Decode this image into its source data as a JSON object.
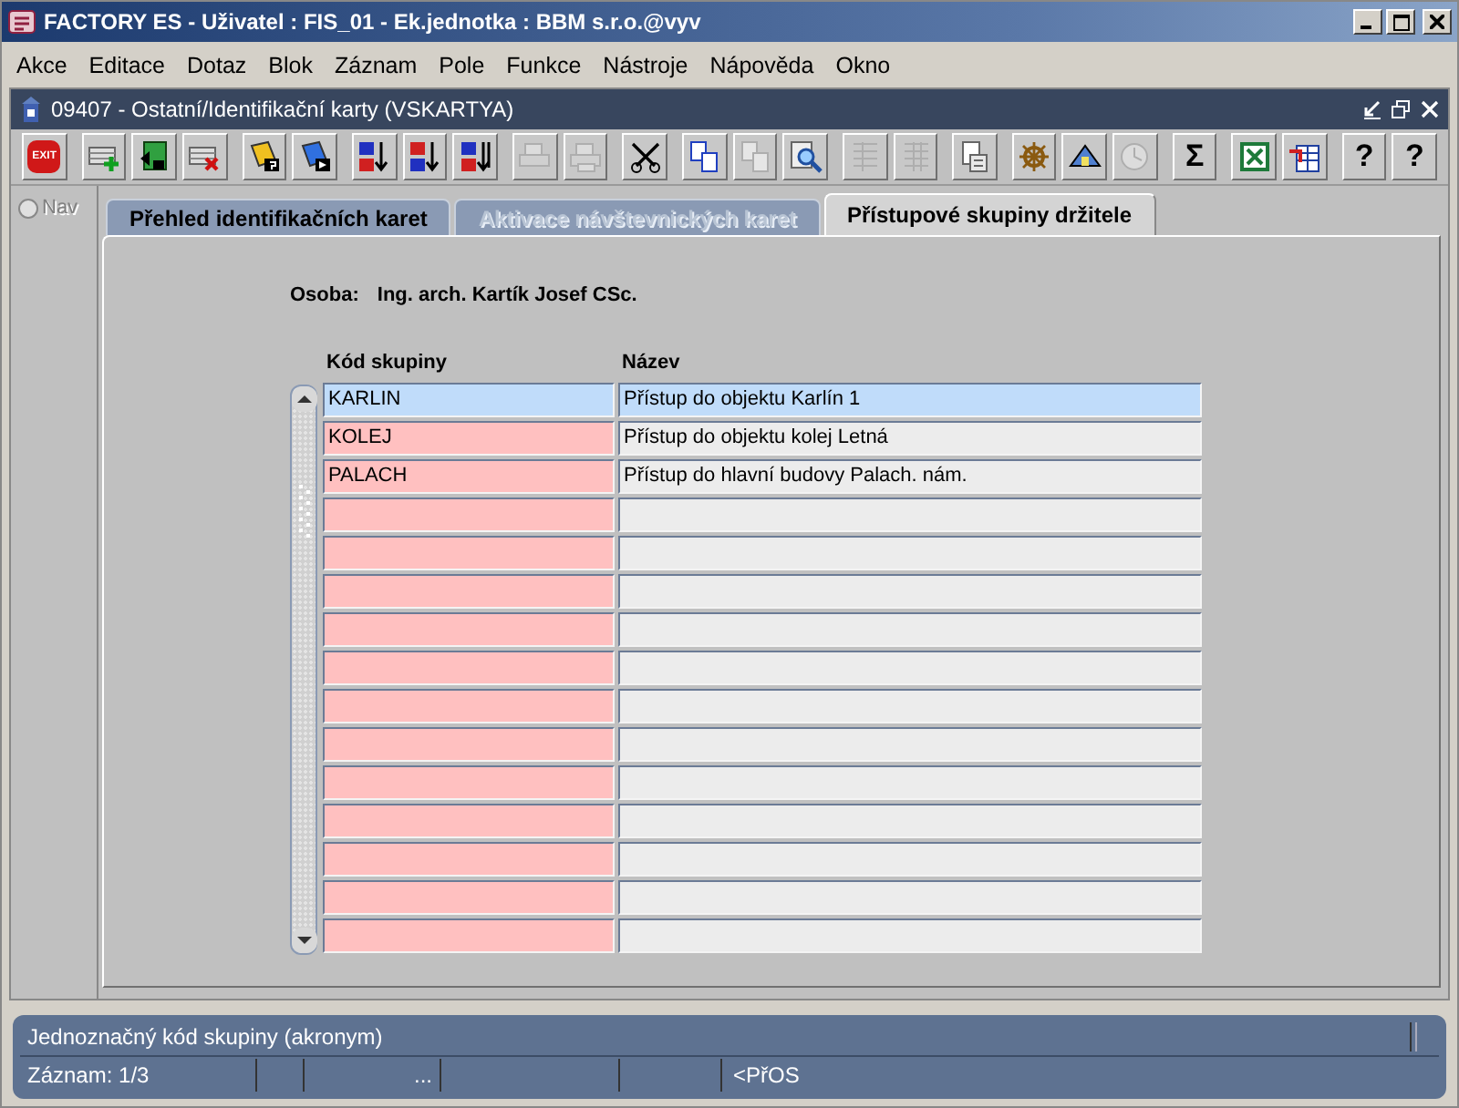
{
  "window": {
    "title": "FACTORY ES - Uživatel : FIS_01 - Ek.jednotka : BBM s.r.o.@vyv"
  },
  "menu": [
    {
      "label": "Akce"
    },
    {
      "label": "Editace"
    },
    {
      "label": "Dotaz"
    },
    {
      "label": "Blok"
    },
    {
      "label": "Záznam"
    },
    {
      "label": "Pole"
    },
    {
      "label": "Funkce"
    },
    {
      "label": "Nástroje"
    },
    {
      "label": "Nápověda"
    },
    {
      "label": "Okno"
    }
  ],
  "form": {
    "title": "09407 - Ostatní/Identifikační karty (VSKARTYA)"
  },
  "toolbar": [
    {
      "kind": "exit",
      "label": "EXIT",
      "disabled": false
    },
    {
      "kind": "add",
      "disabled": false
    },
    {
      "kind": "save",
      "disabled": false
    },
    {
      "kind": "delete",
      "disabled": false
    },
    {
      "kind": "query",
      "disabled": false
    },
    {
      "kind": "run",
      "disabled": false
    },
    {
      "kind": "sort-asc",
      "disabled": false
    },
    {
      "kind": "sort-desc",
      "disabled": false
    },
    {
      "kind": "sort-multi",
      "disabled": false
    },
    {
      "kind": "print",
      "disabled": true
    },
    {
      "kind": "preview",
      "disabled": true
    },
    {
      "kind": "cut",
      "disabled": false
    },
    {
      "kind": "copy",
      "disabled": false
    },
    {
      "kind": "paste",
      "disabled": true
    },
    {
      "kind": "zoom",
      "disabled": false
    },
    {
      "kind": "list",
      "disabled": true
    },
    {
      "kind": "columns",
      "disabled": true
    },
    {
      "kind": "doc",
      "disabled": false
    },
    {
      "kind": "wheel",
      "disabled": false
    },
    {
      "kind": "house",
      "disabled": false
    },
    {
      "kind": "clock",
      "disabled": true
    },
    {
      "kind": "text",
      "label": "Σ",
      "disabled": false
    },
    {
      "kind": "excel",
      "disabled": false
    },
    {
      "kind": "table",
      "disabled": false
    },
    {
      "kind": "text",
      "label": "?",
      "disabled": false
    },
    {
      "kind": "text",
      "label": "?",
      "disabled": false
    }
  ],
  "nav": {
    "label": "Nav",
    "disabled": true
  },
  "tabs": [
    {
      "label": "Přehled identifikačních karet",
      "selected": false,
      "disabled": false
    },
    {
      "label": "Aktivace návštevnických karet",
      "selected": false,
      "disabled": true
    },
    {
      "label": "Přístupové skupiny držitele",
      "selected": true,
      "disabled": false
    }
  ],
  "person": {
    "label": "Osoba:",
    "value": "Ing. arch. Kartík Josef CSc."
  },
  "table": {
    "columns": [
      "Kód skupiny",
      "Název"
    ],
    "rows": [
      {
        "code": "KARLIN",
        "name": "Přístup do objektu Karlín 1",
        "selected": true
      },
      {
        "code": "KOLEJ",
        "name": "Přístup do objektu kolej Letná",
        "selected": false
      },
      {
        "code": "PALACH",
        "name": "Přístup do hlavní budovy Palach. nám.",
        "selected": false
      }
    ]
  },
  "status_bar": {
    "message": "Jednoznačný kód skupiny (akronym)",
    "record": "Záznam: 1/3",
    "ellipsis": "...",
    "mode": "<PřOS"
  }
}
